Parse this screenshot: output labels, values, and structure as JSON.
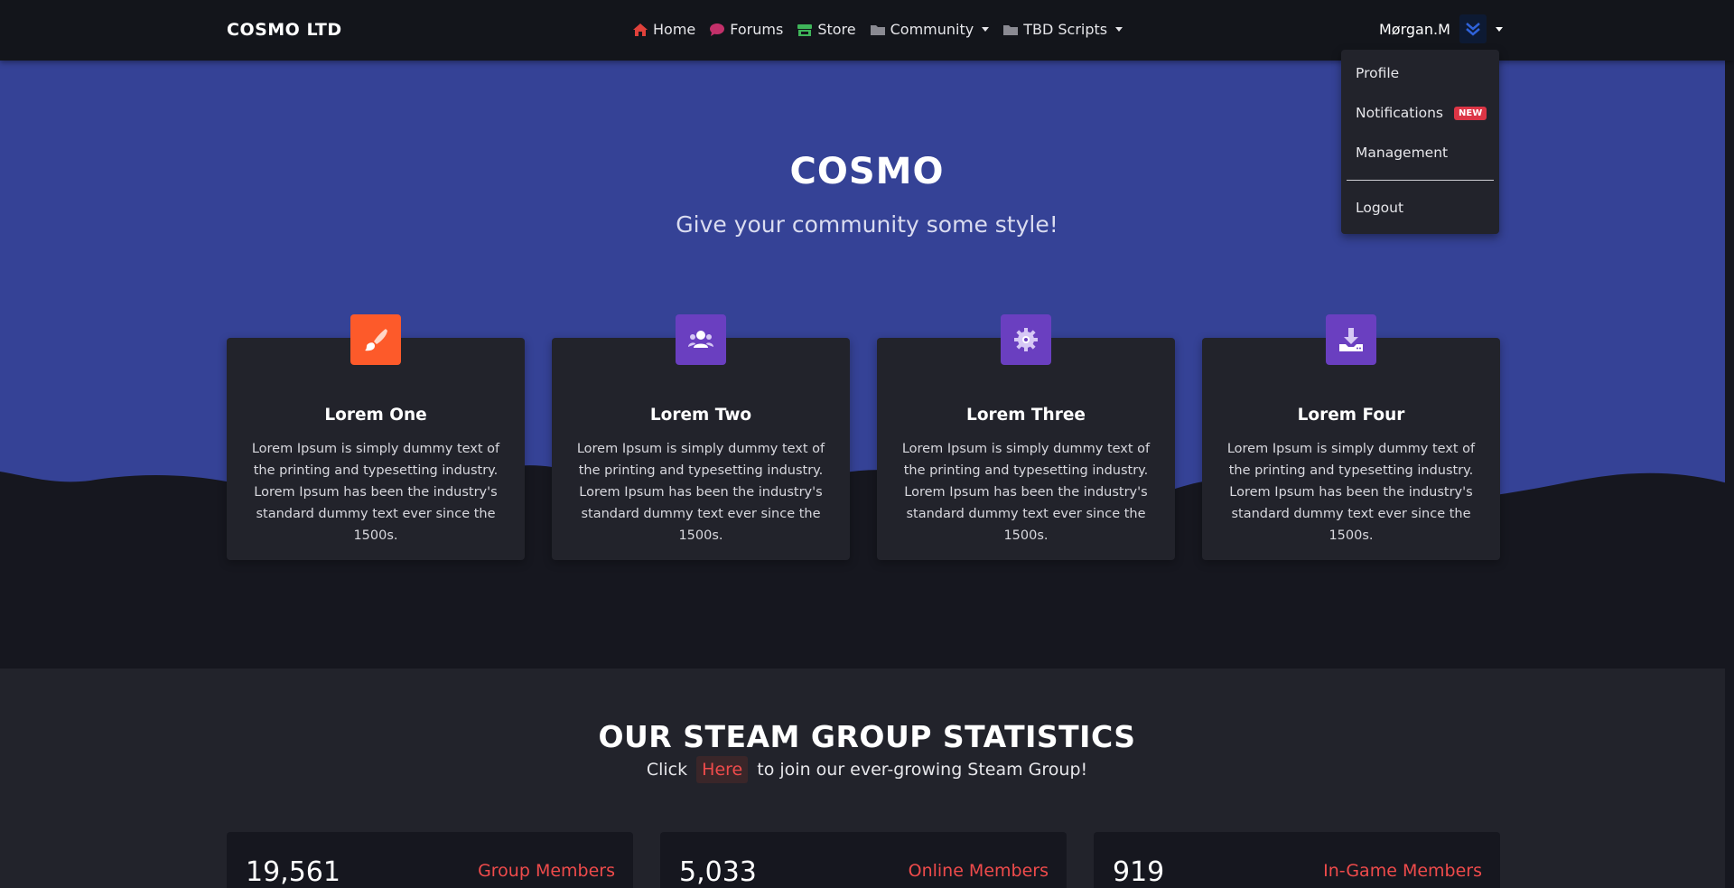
{
  "navbar": {
    "brand": "COSMO LTD",
    "links": [
      {
        "label": "Home",
        "icon": "home-icon",
        "color": "#e0413b",
        "dropdown": false
      },
      {
        "label": "Forums",
        "icon": "chat-icon",
        "color": "#c3306a",
        "dropdown": false
      },
      {
        "label": "Store",
        "icon": "store-icon",
        "color": "#3fb55a",
        "dropdown": false
      },
      {
        "label": "Community",
        "icon": "folder-icon",
        "color": "#8a8a92",
        "dropdown": true
      },
      {
        "label": "TBD Scripts",
        "icon": "folder-icon",
        "color": "#8a8a92",
        "dropdown": true
      }
    ],
    "username": "Mørgan.M"
  },
  "user_menu": {
    "items": [
      {
        "label": "Profile"
      },
      {
        "label": "Notifications",
        "badge": "NEW"
      },
      {
        "label": "Management"
      },
      {
        "label": "Logout"
      }
    ]
  },
  "hero": {
    "title": "COSMO",
    "subtitle": "Give your community some style!",
    "cards": [
      {
        "title": "Lorem One",
        "text": "Lorem Ipsum is simply dummy text of the printing and typesetting industry. Lorem Ipsum has been the industry's standard dummy text ever since the 1500s.",
        "icon": "brush-icon",
        "icon_color": "#fd5a2a"
      },
      {
        "title": "Lorem Two",
        "text": "Lorem Ipsum is simply dummy text of the printing and typesetting industry. Lorem Ipsum has been the industry's standard dummy text ever since the 1500s.",
        "icon": "users-icon",
        "icon_color": "#6a3fc0"
      },
      {
        "title": "Lorem Three",
        "text": "Lorem Ipsum is simply dummy text of the printing and typesetting industry. Lorem Ipsum has been the industry's standard dummy text ever since the 1500s.",
        "icon": "gear-icon",
        "icon_color": "#6a3fc0"
      },
      {
        "title": "Lorem Four",
        "text": "Lorem Ipsum is simply dummy text of the printing and typesetting industry. Lorem Ipsum has been the industry's standard dummy text ever since the 1500s.",
        "icon": "download-icon",
        "icon_color": "#6a3fc0"
      }
    ]
  },
  "stats": {
    "title": "OUR STEAM GROUP STATISTICS",
    "sub_before": "Click",
    "sub_link": "Here",
    "sub_after": "to join our ever-growing Steam Group!",
    "items": [
      {
        "value": "19,561",
        "label": "Group Members"
      },
      {
        "value": "5,033",
        "label": "Online Members"
      },
      {
        "value": "919",
        "label": "In-Game Members"
      }
    ]
  },
  "colors": {
    "hero_blue": "#354296",
    "accent_red": "#ef4b4b",
    "dark_bg": "#16171f",
    "card_bg": "#22232b"
  }
}
